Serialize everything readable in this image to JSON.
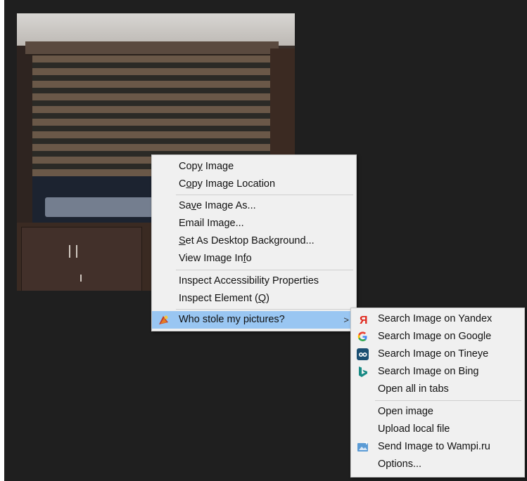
{
  "context_menu": {
    "items": [
      {
        "pre": "Cop",
        "key": "y",
        "post": " Image"
      },
      {
        "pre": "C",
        "key": "o",
        "post": "py Image Location"
      },
      {
        "pre": "Sa",
        "key": "v",
        "post": "e Image As..."
      },
      {
        "pre": "Email Ima",
        "key": "g",
        "post": "e..."
      },
      {
        "pre": "",
        "key": "S",
        "post": "et As Desktop Background..."
      },
      {
        "pre": "View Image In",
        "key": "f",
        "post": "o"
      },
      {
        "pre": "Inspect Accessibility Properties",
        "key": "",
        "post": ""
      },
      {
        "pre": "Inspect Element (",
        "key": "Q",
        "post": ")"
      },
      {
        "pre": "Who stole my pictures?",
        "key": "",
        "post": ""
      }
    ],
    "submenu_arrow": ">"
  },
  "submenu": {
    "items": [
      {
        "label": "Search Image on Yandex",
        "icon": "yandex-icon"
      },
      {
        "label": "Search Image on Google",
        "icon": "google-icon"
      },
      {
        "label": "Search Image on Tineye",
        "icon": "tineye-icon"
      },
      {
        "label": "Search Image on Bing",
        "icon": "bing-icon"
      },
      {
        "label": "Open all in tabs",
        "icon": ""
      },
      {
        "label": "Open image",
        "icon": ""
      },
      {
        "label": "Upload local file",
        "icon": ""
      },
      {
        "label": "Send Image to Wampi.ru",
        "icon": "wampi-icon"
      },
      {
        "label": "Options...",
        "icon": ""
      }
    ]
  },
  "colors": {
    "highlight": "#99c6f2",
    "menu_bg": "#f0f0f0",
    "yandex": "#e0261b",
    "bing": "#178a84"
  }
}
